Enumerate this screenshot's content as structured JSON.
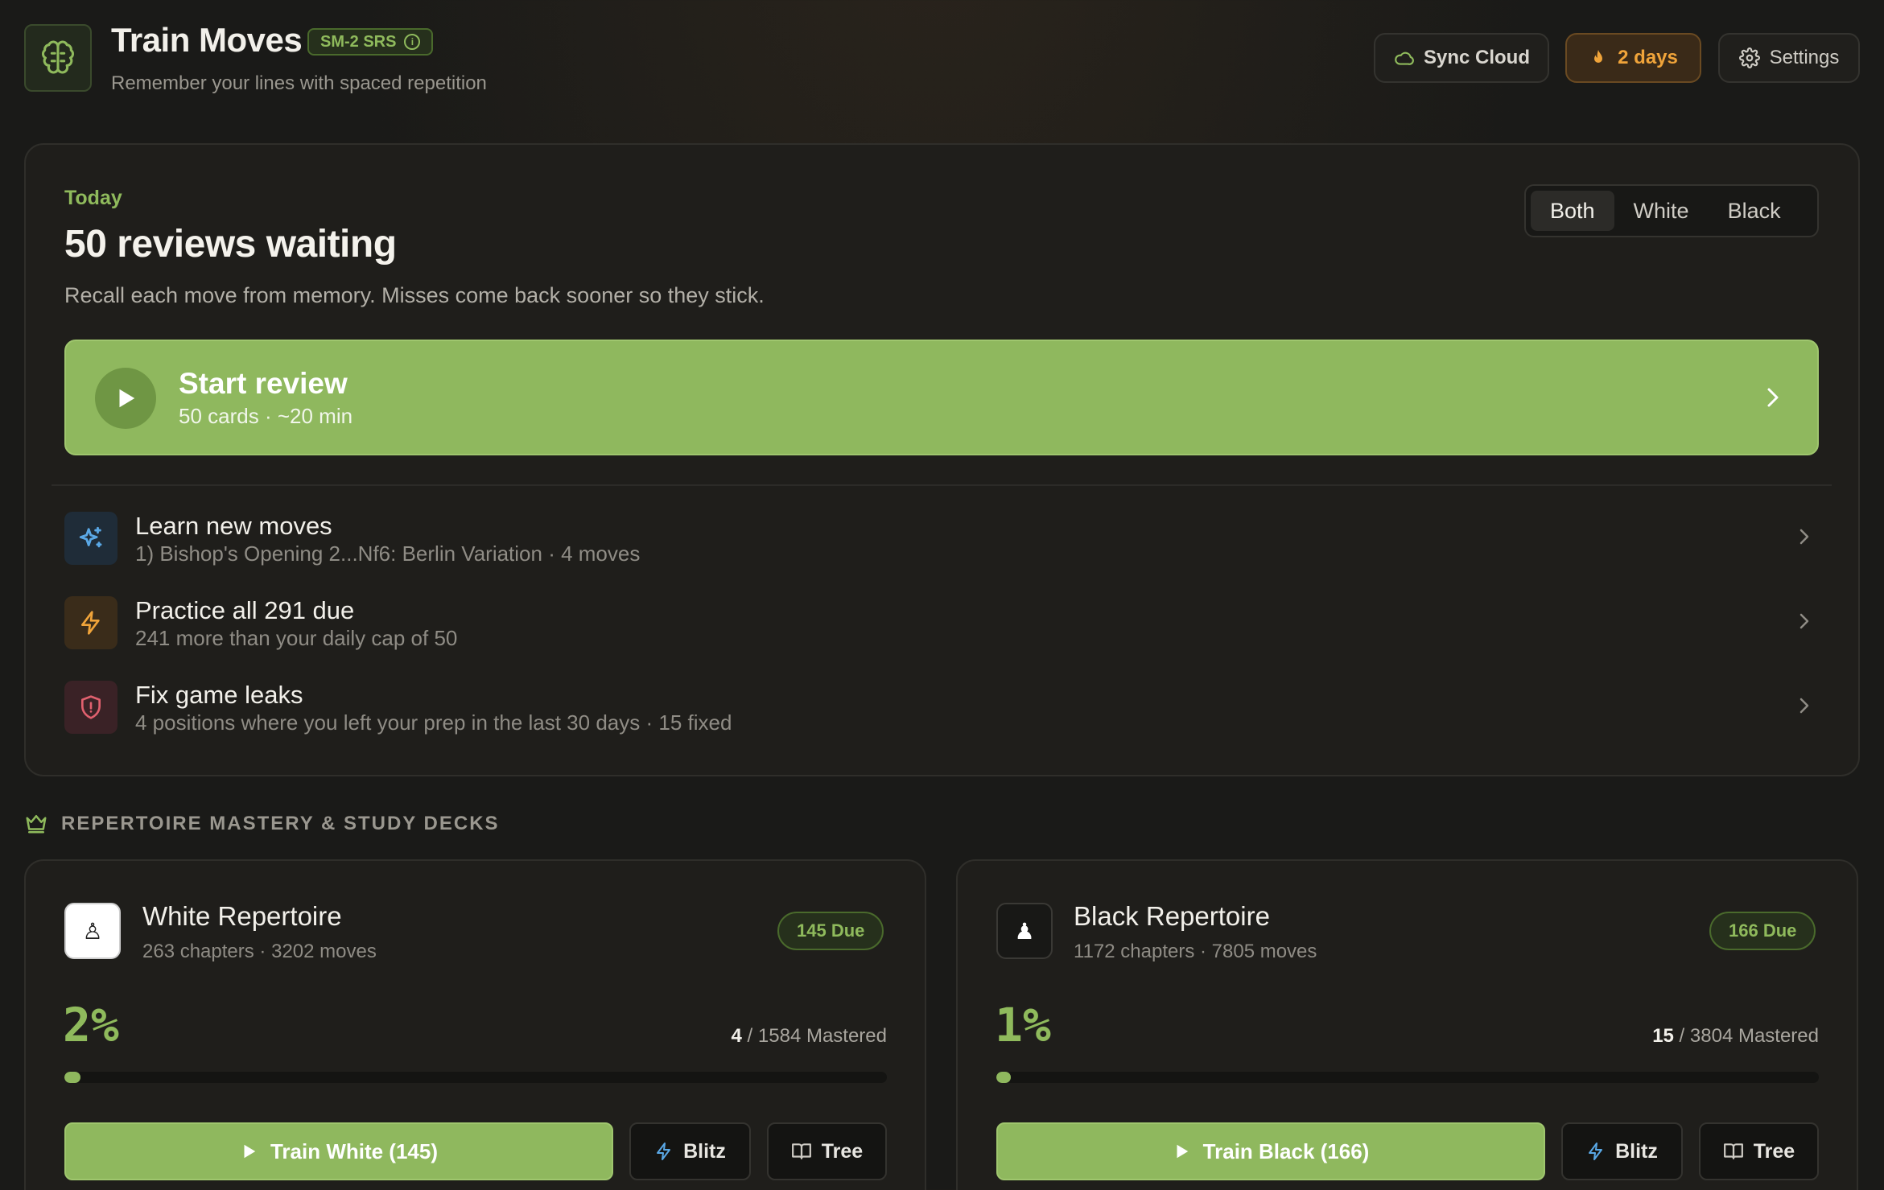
{
  "header": {
    "title": "Train Moves",
    "badge": "SM-2 SRS",
    "subtitle": "Remember your lines with spaced repetition",
    "sync_label": "Sync Cloud",
    "streak_label": "2 days",
    "settings_label": "Settings"
  },
  "today": {
    "label": "Today",
    "title": "50 reviews waiting",
    "description": "Recall each move from memory. Misses come back sooner so they stick.",
    "filter": {
      "options": [
        "Both",
        "White",
        "Black"
      ],
      "selected": "Both"
    },
    "start": {
      "title": "Start review",
      "subtitle": "50 cards · ~20 min"
    },
    "actions": [
      {
        "title": "Learn new moves",
        "subtitle": "1) Bishop's Opening 2...Nf6: Berlin Variation · 4 moves",
        "icon": "sparkle-icon"
      },
      {
        "title": "Practice all 291 due",
        "subtitle": "241 more than your daily cap of 50",
        "icon": "lightning-icon"
      },
      {
        "title": "Fix game leaks",
        "subtitle": "4 positions where you left your prep in the last 30 days · 15 fixed",
        "icon": "shield-alert-icon"
      }
    ]
  },
  "section_title": "REPERTOIRE MASTERY & STUDY DECKS",
  "decks": [
    {
      "title": "White Repertoire",
      "subtitle": "263 chapters · 3202 moves",
      "due": "145 Due",
      "percent": "2%",
      "mastered_count": "4",
      "mastered_rest": " / 1584 Mastered",
      "progress": 0.02,
      "train_label": "Train White (145)",
      "blitz_label": "Blitz",
      "tree_label": "Tree",
      "pawn": "♙"
    },
    {
      "title": "Black Repertoire",
      "subtitle": "1172 chapters · 7805 moves",
      "due": "166 Due",
      "percent": "1%",
      "mastered_count": "15",
      "mastered_rest": " / 3804 Mastered",
      "progress": 0.01,
      "train_label": "Train Black (166)",
      "blitz_label": "Blitz",
      "tree_label": "Tree",
      "pawn": "♟"
    }
  ],
  "colors": {
    "accent_green": "#8fb85e",
    "streak_amber": "#f0a43a",
    "background": "#1a1a18"
  }
}
